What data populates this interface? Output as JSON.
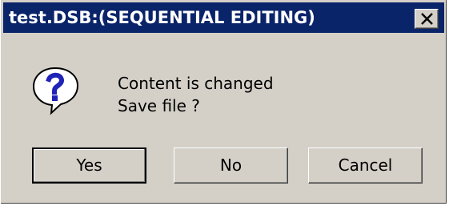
{
  "window": {
    "title": "test.DSB:(SEQUENTIAL EDITING)",
    "close_icon": "close-x-icon",
    "title_bar_color": "#0a246a"
  },
  "message": {
    "icon": "question-icon",
    "line1": "Content is changed",
    "line2": "Save file ?"
  },
  "buttons": {
    "yes": "Yes",
    "no": "No",
    "cancel": "Cancel"
  }
}
